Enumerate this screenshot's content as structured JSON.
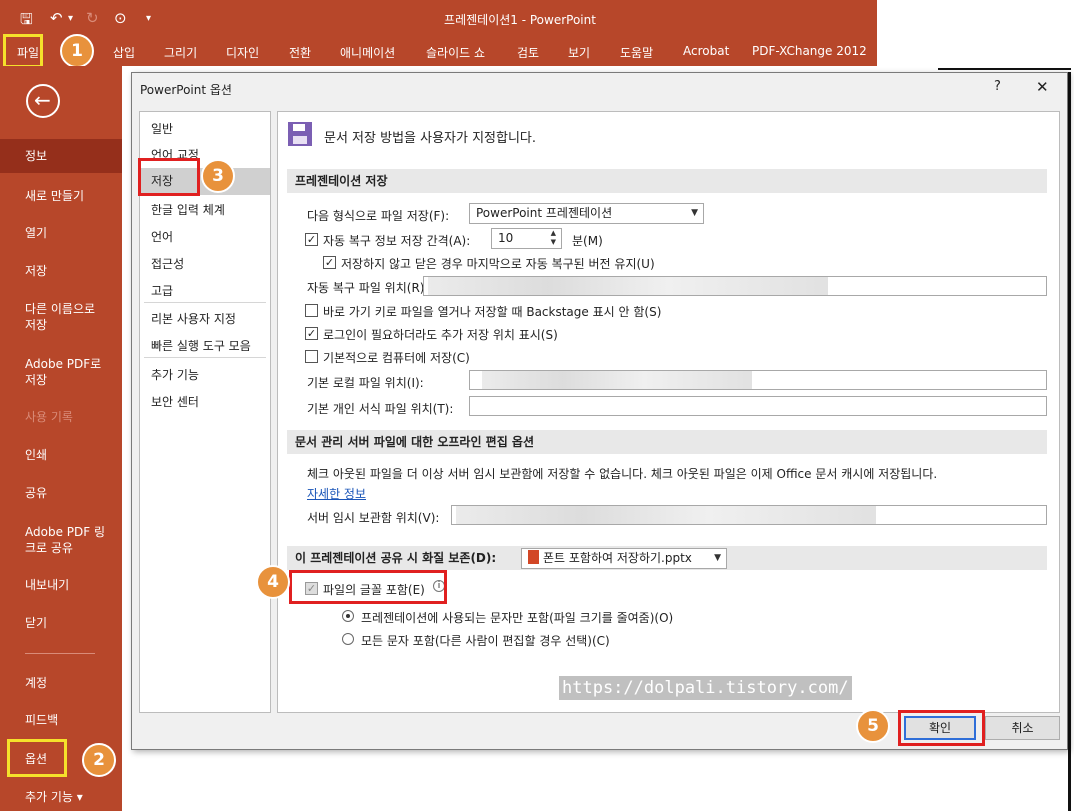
{
  "ribbon": {
    "title": "프레젠테이션1  -  PowerPoint",
    "tabs": [
      "파일",
      "삽입",
      "그리기",
      "디자인",
      "전환",
      "애니메이션",
      "슬라이드 쇼",
      "검토",
      "보기",
      "도움말",
      "Acrobat",
      "PDF-XChange 2012"
    ],
    "qat_icons": [
      "save-icon",
      "undo-icon",
      "redo-icon",
      "presenter-icon",
      "customize-icon"
    ]
  },
  "backstage": {
    "items": [
      "정보",
      "새로 만들기",
      "열기",
      "저장",
      "다른 이름으로 저장",
      "Adobe PDF로 저장",
      "사용 기록",
      "인쇄",
      "공유",
      "Adobe PDF 링크로 공유",
      "내보내기",
      "닫기",
      "계정",
      "피드백",
      "옵션",
      "추가 기능 ▾"
    ],
    "items_split": {
      "saveas_1": "다른 이름으로",
      "saveas_2": "저장",
      "adobe_1": "Adobe PDF로",
      "adobe_2": "저장",
      "adobelink_1": "Adobe PDF 링",
      "adobelink_2": "크로 공유"
    }
  },
  "dialog": {
    "title": "PowerPoint 옵션",
    "help": "?",
    "close": "✕",
    "categories": [
      "일반",
      "언어 교정",
      "저장",
      "한글 입력 체계",
      "언어",
      "접근성",
      "고급",
      "리본 사용자 지정",
      "빠른 실행 도구 모음",
      "추가 기능",
      "보안 센터"
    ],
    "header": "문서 저장 방법을 사용자가 지정합니다.",
    "section_save": "프레젠테이션 저장",
    "format_label": "다음 형식으로 파일 저장(F):",
    "format_value": "PowerPoint 프레젠테이션",
    "autorecover_label": "자동 복구 정보 저장 간격(A):",
    "autorecover_value": "10",
    "minutes": "분(M)",
    "keep_last": "저장하지 않고 닫은 경우 마지막으로 자동 복구된 버전 유지(U)",
    "autorecover_loc": "자동 복구 파일 위치(R):",
    "no_backstage": "바로 가기 키로 파일을 열거나 저장할 때 Backstage 표시 안 함(S)",
    "show_extra": "로그인이 필요하더라도 추가 저장 위치 표시(S)",
    "save_to_computer": "기본적으로 컴퓨터에 저장(C)",
    "default_local": "기본 로컬 파일 위치(I):",
    "default_template": "기본 개인 서식 파일 위치(T):",
    "section_offline": "문서 관리 서버 파일에 대한 오프라인 편집 옵션",
    "offline_text": "체크 아웃된 파일을 더 이상 서버 임시 보관함에 저장할 수 없습니다. 체크 아웃된 파일은 이제 Office 문서 캐시에 저장됩니다.",
    "more_info": "자세한 정보",
    "server_drafts": "서버 임시 보관함 위치(V):",
    "section_fidelity": "이 프레젠테이션 공유 시 화질 보존(D):",
    "fidelity_file": "폰트 포함하여 저장하기.pptx",
    "embed_fonts": "파일의 글꼴 포함(E)",
    "embed_only_used": "프레젠테이션에 사용되는 문자만 포함(파일 크기를 줄여줌)(O)",
    "embed_all": "모든 문자 포함(다른 사람이 편집할 경우 선택)(C)",
    "ok": "확인",
    "cancel": "취소"
  },
  "annotations": {
    "b1": "1",
    "b2": "2",
    "b3": "3",
    "b4": "4",
    "b5": "5"
  },
  "watermark": "https://dolpali.tistory.com/"
}
